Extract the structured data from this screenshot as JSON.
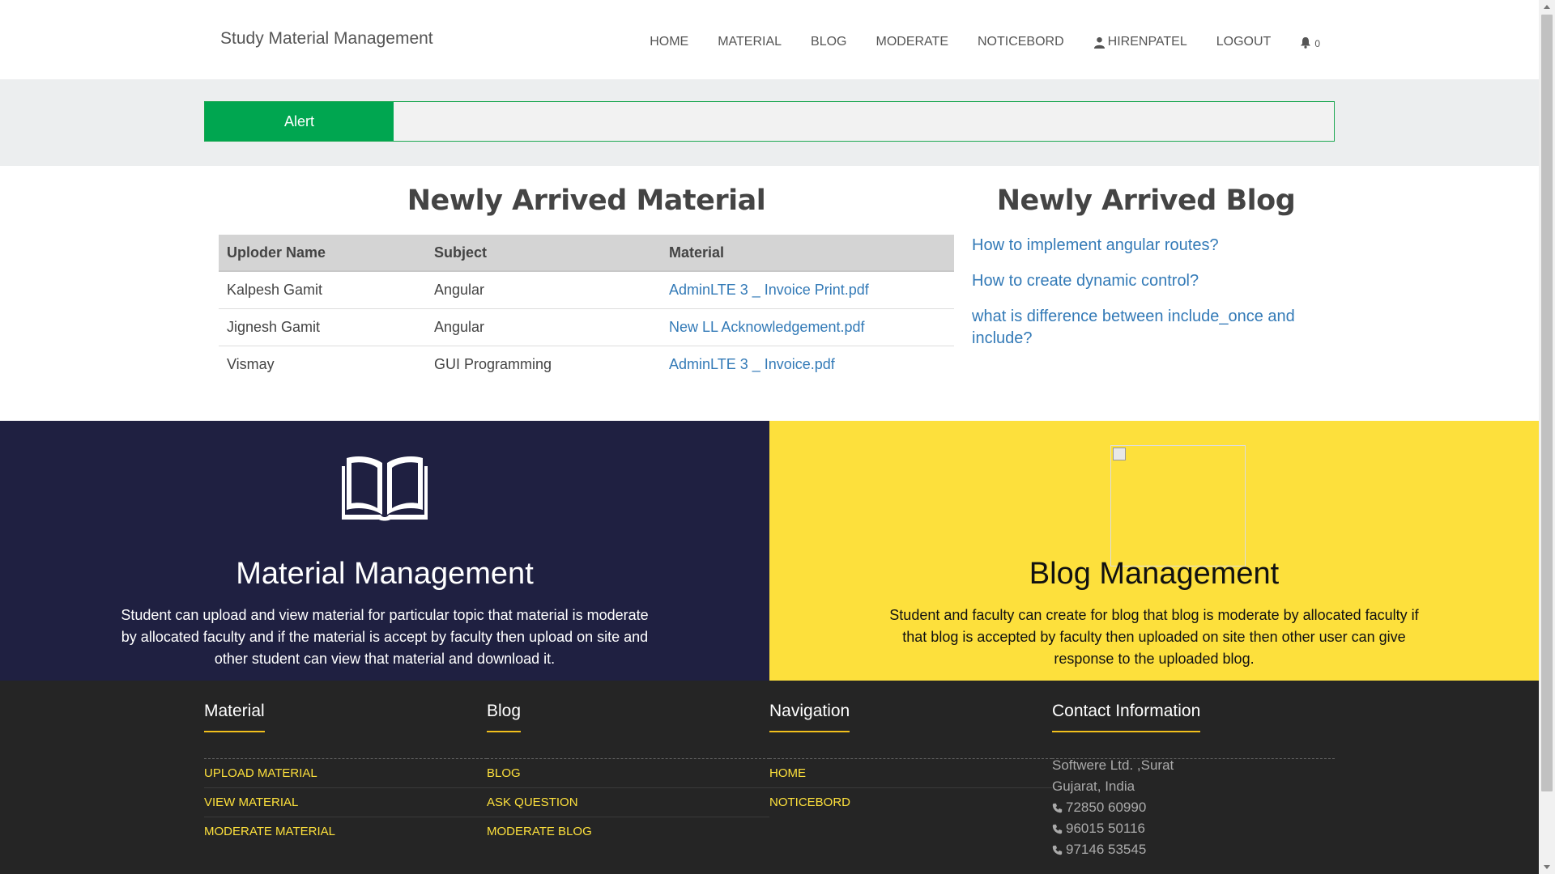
{
  "navbar": {
    "brand": "Study Material Management",
    "items": [
      {
        "label": "HOME"
      },
      {
        "label": "MATERIAL"
      },
      {
        "label": "BLOG"
      },
      {
        "label": "MODERATE"
      },
      {
        "label": "NOTICEBORD"
      },
      {
        "label": "HIRENPATEL",
        "icon": "user-icon"
      },
      {
        "label": "LOGOUT"
      }
    ],
    "notification_count": "0",
    "notification_icon": "bell-icon"
  },
  "alert": {
    "label": "Alert",
    "message": ""
  },
  "material_section": {
    "title": "Newly Arrived Material",
    "columns": [
      "Uploder Name",
      "Subject",
      "Material"
    ],
    "rows": [
      {
        "uploader": "Kalpesh Gamit",
        "subject": "Angular",
        "material": "AdminLTE 3 _ Invoice Print.pdf"
      },
      {
        "uploader": "Jignesh Gamit",
        "subject": "Angular",
        "material": "New LL Acknowledgement.pdf"
      },
      {
        "uploader": "Vismay",
        "subject": "GUI Programming",
        "material": "AdminLTE 3 _ Invoice.pdf"
      }
    ]
  },
  "blog_section": {
    "title": "Newly Arrived Blog",
    "posts": [
      "How to implement angular routes?",
      "How to create dynamic control?",
      "what is difference between include_once and include?"
    ]
  },
  "features": {
    "material": {
      "icon": "open-book-icon",
      "heading": "Material Management",
      "text": "Student can upload and view material for particular topic that material is moderate by allocated faculty and if the material is accept by faculty then upload on site and other student can view that material and download it."
    },
    "blog": {
      "icon": "broken-image-icon",
      "heading": "Blog Management",
      "text": "Student and faculty can create for blog that blog is moderate by allocated faculty if that blog is accepted by faculty then uploaded on site then other user can give response to the uploaded blog."
    }
  },
  "footer": {
    "material": {
      "title": "Material",
      "links": [
        "UPLOAD MATERIAL",
        "VIEW MATERIAL",
        "MODERATE MATERIAL"
      ]
    },
    "blog": {
      "title": "Blog",
      "links": [
        "BLOG",
        "ASK QUESTION",
        "MODERATE BLOG"
      ]
    },
    "navigation": {
      "title": "Navigation",
      "links": [
        "HOME",
        "NOTICEBORD"
      ]
    },
    "contact": {
      "title": "Contact Information",
      "address_line1": "Softwere Ltd. ,Surat",
      "address_line2": "Gujarat, India",
      "phones": [
        "72850 60990",
        "96015 50116",
        "97146 53545"
      ]
    }
  },
  "colors": {
    "alert_green": "#00a650",
    "panel_dark": "#1f2041",
    "panel_yellow": "#fde03c",
    "footer_bg": "#252525",
    "link_blue": "#337ab7"
  }
}
